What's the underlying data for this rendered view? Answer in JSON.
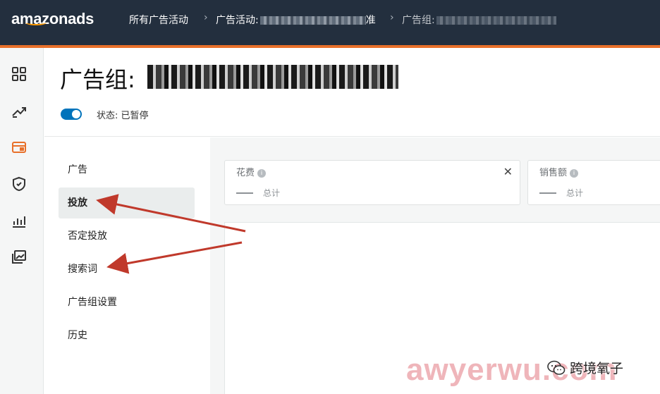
{
  "topbar": {
    "logo_text": "amazonads",
    "breadcrumb": {
      "campaigns": "所有广告活动",
      "campaign_prefix": "广告活动:",
      "campaign_tail": "准",
      "adgroup_prefix": "广告组:"
    }
  },
  "leftnav": {
    "icons": [
      "dashboard-icon",
      "trend-icon",
      "campaign-icon",
      "shield-icon",
      "bar-chart-icon",
      "gallery-icon"
    ],
    "active_color": "#e8702a"
  },
  "header": {
    "title_prefix": "广告组:",
    "status_label": "状态: 已暂停",
    "toggle_color": "#0073bb"
  },
  "subnav": {
    "items": [
      {
        "label": "广告"
      },
      {
        "label": "投放"
      },
      {
        "label": "否定投放"
      },
      {
        "label": "搜索词"
      },
      {
        "label": "广告组设置"
      },
      {
        "label": "历史"
      }
    ],
    "active_index": 1
  },
  "metrics": [
    {
      "label": "花费",
      "total": "总计"
    },
    {
      "label": "销售额",
      "total": "总计"
    }
  ],
  "annotations": {
    "arrow_color": "#c0392b"
  },
  "watermark": {
    "text": "awyerwu.com",
    "wechat_account": "跨境氧子"
  }
}
